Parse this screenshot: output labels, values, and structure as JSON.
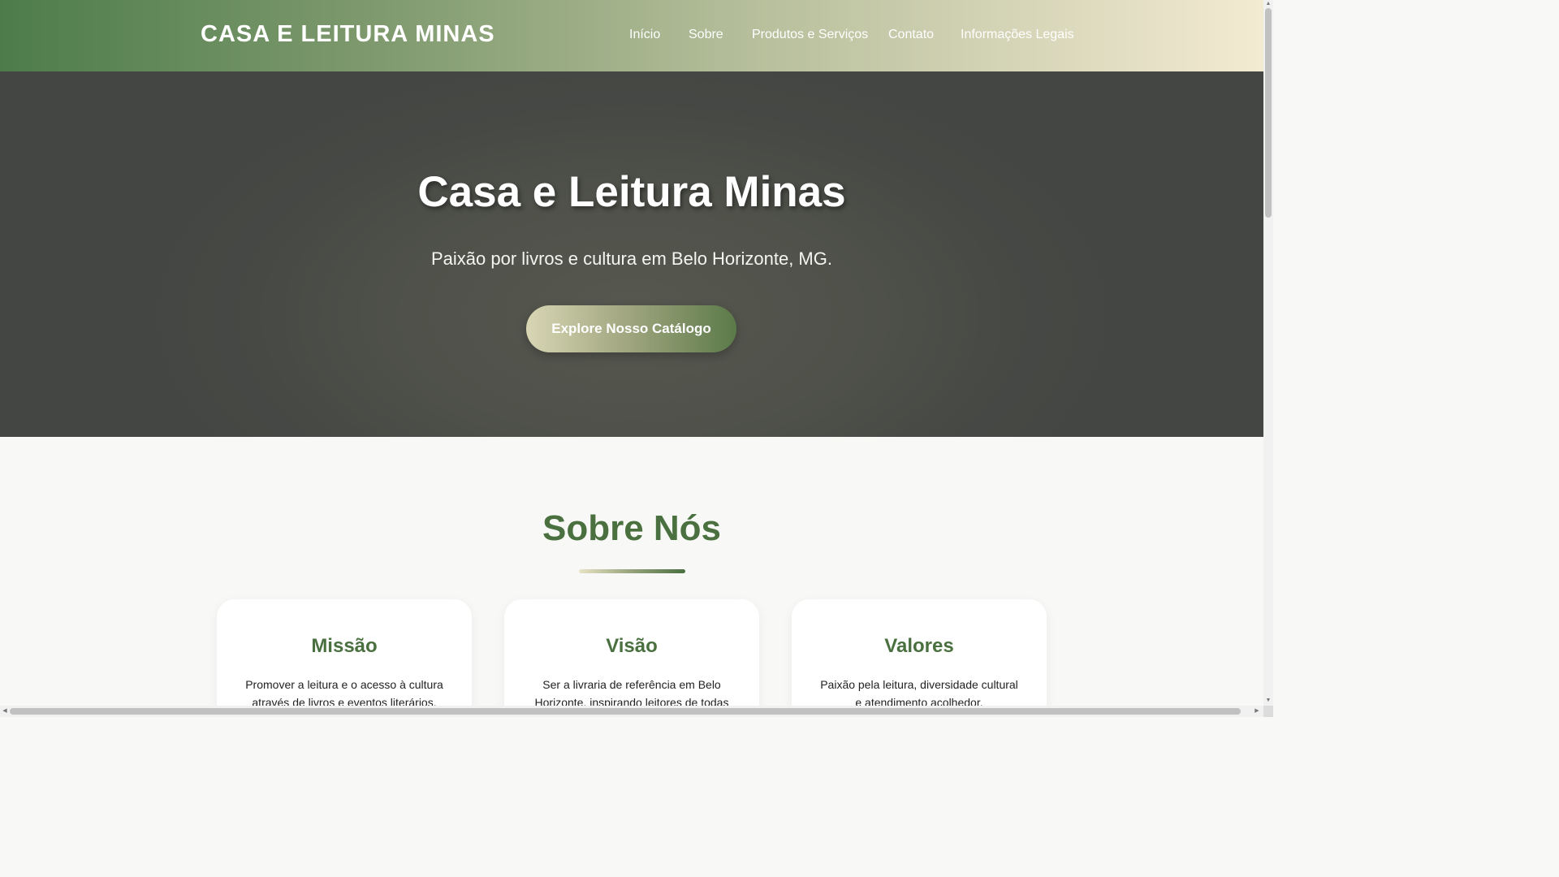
{
  "header": {
    "brand": "CASA E LEITURA MINAS",
    "nav": [
      {
        "label": "Início"
      },
      {
        "label": "Sobre"
      },
      {
        "label": "Produtos e Serviços"
      },
      {
        "label": "Contato"
      },
      {
        "label": "Informações Legais"
      }
    ]
  },
  "hero": {
    "title": "Casa e Leitura Minas",
    "subtitle": "Paixão por livros e cultura em Belo Horizonte, MG.",
    "cta_label": "Explore Nosso Catálogo"
  },
  "about": {
    "title": "Sobre Nós",
    "cards": [
      {
        "title": "Missão",
        "text": "Promover a leitura e o acesso à cultura através de livros e eventos literários."
      },
      {
        "title": "Visão",
        "text": "Ser a livraria de referência em Belo Horizonte, inspirando leitores de todas"
      },
      {
        "title": "Valores",
        "text": "Paixão pela leitura, diversidade cultural e atendimento acolhedor."
      }
    ]
  },
  "scrollbars": {
    "up_arrow": "▲",
    "down_arrow": "▼",
    "left_arrow": "◀",
    "right_arrow": "▶"
  },
  "colors": {
    "accent_green": "#4a7040",
    "hero_bg": "#4f514a",
    "header_gradient_start": "#4d7c4a",
    "header_gradient_end": "#f3ead2"
  }
}
